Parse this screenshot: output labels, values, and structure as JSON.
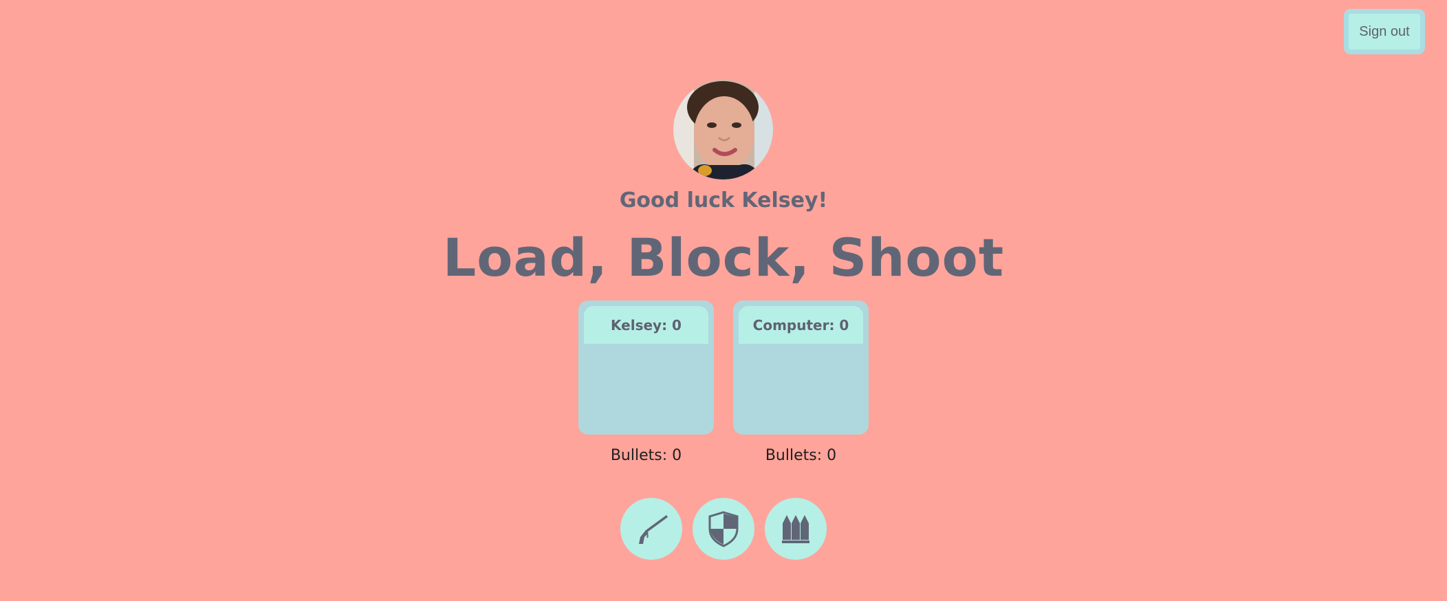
{
  "header": {
    "signout_label": "Sign out"
  },
  "profile": {
    "avatar": "user-photo",
    "greeting": "Good luck Kelsey!"
  },
  "game": {
    "title": "Load, Block, Shoot",
    "player": {
      "score_label": "Kelsey: 0",
      "bullets_label": "Bullets: 0"
    },
    "computer": {
      "score_label": "Computer: 0",
      "bullets_label": "Bullets: 0"
    }
  },
  "actions": [
    {
      "icon": "shotgun-icon"
    },
    {
      "icon": "shield-icon"
    },
    {
      "icon": "bullets-icon"
    }
  ],
  "colors": {
    "background": "#ffa49b",
    "accent": "#b6efe6",
    "card": "#aed8de",
    "text": "#616677"
  }
}
